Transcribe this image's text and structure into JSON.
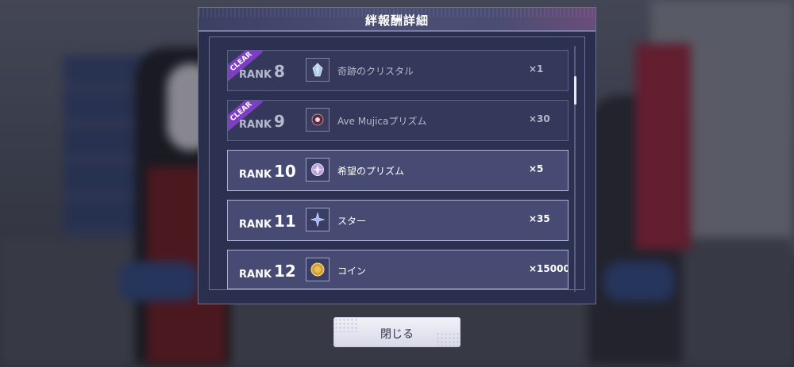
{
  "modal": {
    "title": "絆報酬詳細",
    "close_label": "閉じる"
  },
  "ranks": [
    {
      "rank_label": "RANK",
      "rank_number": "8",
      "badge": "CLEAR",
      "item_icon": "crystal-icon",
      "item_name": "奇跡のクリスタル",
      "quantity": "×1",
      "cleared": true
    },
    {
      "rank_label": "RANK",
      "rank_number": "9",
      "badge": "CLEAR",
      "item_icon": "ave-mujica-prism-icon",
      "item_name": "Ave Mujicaプリズム",
      "quantity": "×30",
      "cleared": true
    },
    {
      "rank_label": "RANK",
      "rank_number": "10",
      "item_icon": "hope-prism-icon",
      "item_name": "希望のプリズム",
      "quantity": "×5",
      "cleared": false
    },
    {
      "rank_label": "RANK",
      "rank_number": "11",
      "item_icon": "star-icon",
      "item_name": "スター",
      "quantity": "×35",
      "cleared": false
    },
    {
      "rank_label": "RANK",
      "rank_number": "12",
      "item_icon": "coin-icon",
      "item_name": "コイン",
      "quantity": "×15000",
      "cleared": false
    }
  ],
  "colors": {
    "modal_bg": "#2b2f4e",
    "clear_badge": "#7e3ec4",
    "active_row": "#474b73"
  }
}
